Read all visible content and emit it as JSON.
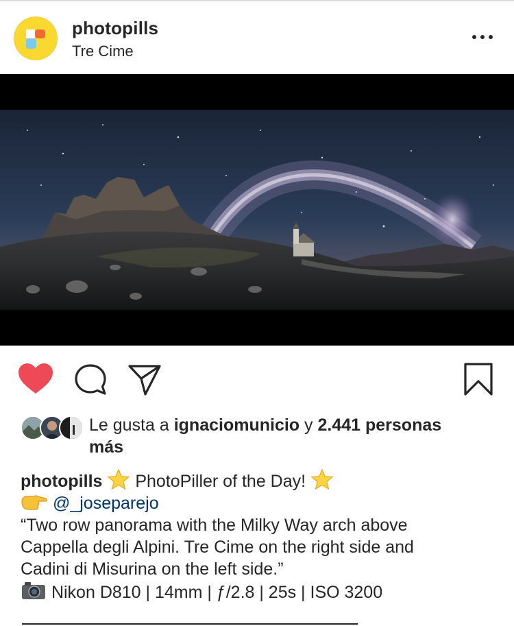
{
  "post": {
    "username": "photopills",
    "location": "Tre Cime"
  },
  "likes": {
    "prefix": "Le gusta a",
    "user": "ignaciomunicio",
    "connector": "y",
    "count": "2.441 personas",
    "suffix": "más"
  },
  "caption": {
    "username": "photopills",
    "title": "PhotoPiller of the Day!",
    "mention": "@_joseparejo",
    "quote_line1": "“Two row panorama with the Milky Way arch above",
    "quote_line2": "Cappella degli Alpini. Tre Cime on the right side and",
    "quote_line3": "Cadini di Misurina on the left side.”",
    "gear": "Nikon D810 | 14mm | ƒ/2.8 | 25s | ISO 3200"
  },
  "icons": {
    "like": "heart-filled-icon",
    "comment": "comment-bubble-icon",
    "share": "paper-plane-icon",
    "save": "bookmark-icon",
    "more": "more-dots-icon"
  },
  "colors": {
    "like_red": "#ed4956",
    "text": "#262626",
    "mention": "#003569",
    "logo_yellow": "#f9d830"
  }
}
